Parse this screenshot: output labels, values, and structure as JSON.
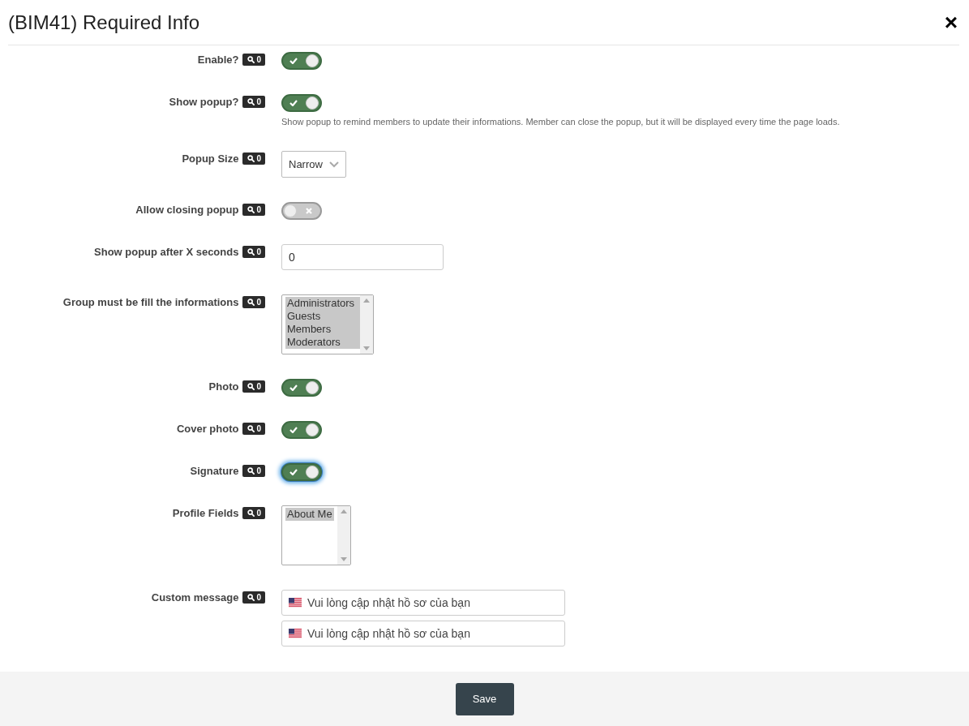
{
  "dialog": {
    "title": "(BIM41) Required Info",
    "close_label": "×"
  },
  "rows": [
    {
      "kind": "toggle",
      "label": "Enable?",
      "count": "0",
      "on": true,
      "focused": false
    },
    {
      "kind": "toggle",
      "label": "Show popup?",
      "count": "0",
      "on": true,
      "focused": false,
      "help": "Show popup to remind members to update their informations. Member can close the popup, but it will be displayed every time the page loads."
    },
    {
      "kind": "select",
      "label": "Popup Size",
      "count": "0",
      "value": "Narrow"
    },
    {
      "kind": "toggle",
      "label": "Allow closing popup",
      "count": "0",
      "on": false,
      "focused": false
    },
    {
      "kind": "number",
      "label": "Show popup after X seconds",
      "count": "0",
      "value": "0"
    },
    {
      "kind": "listbox",
      "label": "Group must be fill the informations",
      "count": "0",
      "options": [
        {
          "label": "Administrators",
          "selected": true
        },
        {
          "label": "Guests",
          "selected": true
        },
        {
          "label": "Members",
          "selected": true
        },
        {
          "label": "Moderators",
          "selected": true
        }
      ]
    },
    {
      "kind": "toggle",
      "label": "Photo",
      "count": "0",
      "on": true,
      "focused": false
    },
    {
      "kind": "toggle",
      "label": "Cover photo",
      "count": "0",
      "on": true,
      "focused": false
    },
    {
      "kind": "toggle",
      "label": "Signature",
      "count": "0",
      "on": true,
      "focused": true
    },
    {
      "kind": "listbox",
      "label": "Profile Fields",
      "count": "0",
      "options": [
        {
          "label": "About Me",
          "selected": true
        }
      ]
    },
    {
      "kind": "translations",
      "label": "Custom message",
      "count": "0",
      "values": [
        "Vui lòng cập nhật hồ sơ của bạn",
        "Vui lòng cập nhật hồ sơ của bạn"
      ]
    }
  ],
  "footer": {
    "save_label": "Save"
  }
}
